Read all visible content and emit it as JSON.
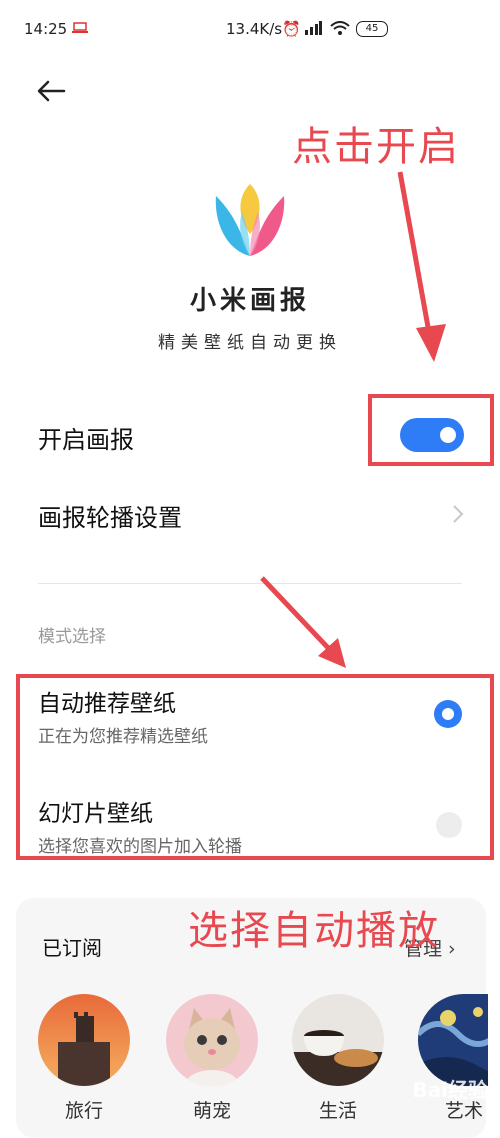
{
  "status_bar": {
    "time": "14:25",
    "speed": "13.4K/s",
    "battery": "45"
  },
  "app": {
    "name": "小米画报",
    "desc": "精美壁纸自动更换"
  },
  "settings": {
    "enable_label": "开启画报",
    "enable_on": true,
    "carousel_label": "画报轮播设置"
  },
  "mode": {
    "section_label": "模式选择",
    "options": [
      {
        "title": "自动推荐壁纸",
        "subtitle": "正在为您推荐精选壁纸",
        "selected": true
      },
      {
        "title": "幻灯片壁纸",
        "subtitle": "选择您喜欢的图片加入轮播",
        "selected": false
      }
    ]
  },
  "subscribed": {
    "title": "已订阅",
    "manage_label": "管理",
    "categories": [
      {
        "label": "旅行",
        "icon": "castle-photo"
      },
      {
        "label": "萌宠",
        "icon": "kitten-photo"
      },
      {
        "label": "生活",
        "icon": "coffee-photo"
      },
      {
        "label": "艺术",
        "icon": "starry-night-photo"
      }
    ]
  },
  "annotations": {
    "top": "点击开启",
    "bottom": "选择自动播放",
    "color": "#e8484f"
  },
  "accent_color": "#2e7cf6",
  "watermark": "Bai经验"
}
